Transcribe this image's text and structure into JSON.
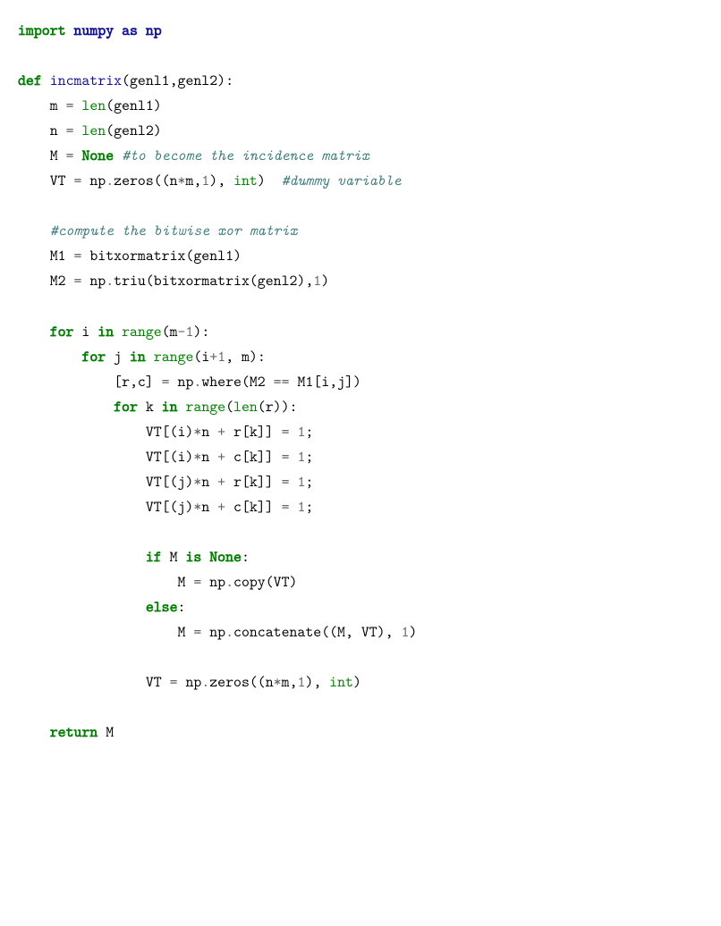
{
  "code": {
    "l1_import": "import",
    "l1_numpy": "numpy",
    "l1_as": "as",
    "l1_np": "np",
    "l3_def": "def",
    "l3_fn": "incmatrix",
    "l3_params": "(genl1,genl2):",
    "l4_m": "m ",
    "l4_eq": "=",
    "l4_len": " len",
    "l4_rest": "(genl1)",
    "l5_n": "n ",
    "l5_eq": "=",
    "l5_len": " len",
    "l5_rest": "(genl2)",
    "l6_M": "M ",
    "l6_eq": "=",
    "l6_sp": " ",
    "l6_none": "None",
    "l6_sp2": " ",
    "l6_c": "#to become the incidence matrix",
    "l7_vt": "VT ",
    "l7_eq": "=",
    "l7_a": " np",
    "l7_b": ".",
    "l7_c": "zeros((n",
    "l7_star": "*",
    "l7_d": "m,",
    "l7_1": "1",
    "l7_e": "), ",
    "l7_int": "int",
    "l7_f": ")  ",
    "l7_cm": "#dummy variable",
    "l9_c": "#compute the bitwise xor matrix",
    "l10_a": "M1 ",
    "l10_eq": "=",
    "l10_b": " bitxormatrix(genl1)",
    "l11_a": "M2 ",
    "l11_eq": "=",
    "l11_b": " np",
    "l11_c": ".",
    "l11_d": "triu(bitxormatrix(genl2),",
    "l11_1": "1",
    "l11_e": ")",
    "l13_for": "for",
    "l13_a": " i ",
    "l13_in": "in",
    "l13_sp": " ",
    "l13_range": "range",
    "l13_b": "(m",
    "l13_minus": "-",
    "l13_1": "1",
    "l13_c": "):",
    "l14_for": "for",
    "l14_a": " j ",
    "l14_in": "in",
    "l14_sp": " ",
    "l14_range": "range",
    "l14_b": "(i",
    "l14_plus": "+",
    "l14_1": "1",
    "l14_c": ", m):",
    "l15_a": "[r,c] ",
    "l15_eq": "=",
    "l15_b": " np",
    "l15_c": ".",
    "l15_d": "where(M2 ",
    "l15_ee": "==",
    "l15_e": " M1[i,j])",
    "l16_for": "for",
    "l16_a": " k ",
    "l16_in": "in",
    "l16_sp": " ",
    "l16_range": "range",
    "l16_lp": "(",
    "l16_len": "len",
    "l16_b": "(r)):",
    "l17_a": "VT[(i)",
    "l17_s": "*",
    "l17_b": "n ",
    "l17_p": "+",
    "l17_c": " r[k]] ",
    "l17_eq": "=",
    "l17_sp": " ",
    "l17_1": "1",
    "l17_d": ";",
    "l18_a": "VT[(i)",
    "l18_s": "*",
    "l18_b": "n ",
    "l18_p": "+",
    "l18_c": " c[k]] ",
    "l18_eq": "=",
    "l18_sp": " ",
    "l18_1": "1",
    "l18_d": ";",
    "l19_a": "VT[(j)",
    "l19_s": "*",
    "l19_b": "n ",
    "l19_p": "+",
    "l19_c": " r[k]] ",
    "l19_eq": "=",
    "l19_sp": " ",
    "l19_1": "1",
    "l19_d": ";",
    "l20_a": "VT[(j)",
    "l20_s": "*",
    "l20_b": "n ",
    "l20_p": "+",
    "l20_c": " c[k]] ",
    "l20_eq": "=",
    "l20_sp": " ",
    "l20_1": "1",
    "l20_d": ";",
    "l22_if": "if",
    "l22_a": " M ",
    "l22_is": "is",
    "l22_sp": " ",
    "l22_none": "None",
    "l22_b": ":",
    "l23_a": "M ",
    "l23_eq": "=",
    "l23_b": " np",
    "l23_c": ".",
    "l23_d": "copy(VT)",
    "l24_else": "else",
    "l24_a": ":",
    "l25_a": "M ",
    "l25_eq": "=",
    "l25_b": " np",
    "l25_c": ".",
    "l25_d": "concatenate((M, VT), ",
    "l25_1": "1",
    "l25_e": ")",
    "l27_a": "VT ",
    "l27_eq": "=",
    "l27_b": " np",
    "l27_c": ".",
    "l27_d": "zeros((n",
    "l27_s": "*",
    "l27_e": "m,",
    "l27_1": "1",
    "l27_f": "), ",
    "l27_int": "int",
    "l27_g": ")",
    "l29_ret": "return",
    "l29_a": " M"
  }
}
